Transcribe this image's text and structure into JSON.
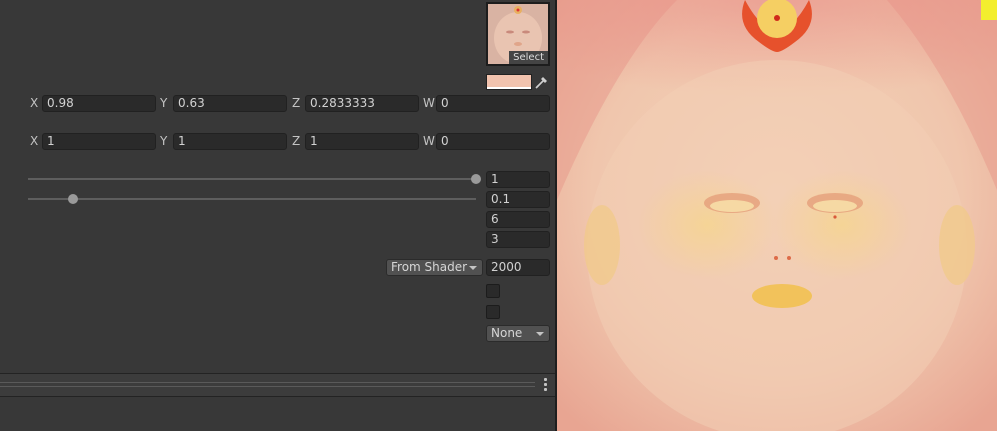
{
  "texture": {
    "select_label": "Select",
    "preview_colors": {
      "skin": "#eec3ac",
      "blush": "#e8958a",
      "eye_shadow": "#e59478",
      "accent": "#ffd257",
      "top_gem": "#e23b1c",
      "corner_mark": "#f3ee2e"
    }
  },
  "color": {
    "value": "#F2C3AE",
    "picker_icon": "eyedropper-icon"
  },
  "vector1": {
    "x": {
      "axis": "X",
      "value": "0.98"
    },
    "y": {
      "axis": "Y",
      "value": "0.63"
    },
    "z": {
      "axis": "Z",
      "value": "0.2833333"
    },
    "w": {
      "axis": "W",
      "value": "0"
    }
  },
  "vector2": {
    "x": {
      "axis": "X",
      "value": "1"
    },
    "y": {
      "axis": "Y",
      "value": "1"
    },
    "z": {
      "axis": "Z",
      "value": "1"
    },
    "w": {
      "axis": "W",
      "value": "0"
    }
  },
  "slider1": {
    "value": "1",
    "fraction": 1.0
  },
  "slider2": {
    "value": "0.1",
    "fraction": 0.1
  },
  "float1": {
    "value": "6"
  },
  "float2": {
    "value": "3"
  },
  "render_queue": {
    "mode": "From Shader",
    "value": "2000"
  },
  "checkbox1": {
    "checked": false
  },
  "checkbox2": {
    "checked": false
  },
  "dropdown": {
    "value": "None"
  }
}
